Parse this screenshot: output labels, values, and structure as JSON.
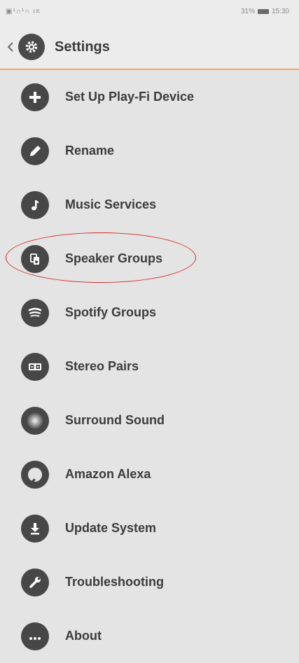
{
  "status_bar": {
    "left_text": "▣¹∩¹∩ ı≡",
    "right_text": "31%",
    "time": "15:30"
  },
  "header": {
    "back_icon": "chevron-left-icon",
    "icon": "gear-icon",
    "title": "Settings",
    "accent_color": "#f0a958"
  },
  "menu": {
    "items": [
      {
        "label": "Set Up Play-Fi Device",
        "icon": "plus-icon"
      },
      {
        "label": "Rename",
        "icon": "pencil-icon"
      },
      {
        "label": "Music Services",
        "icon": "music-note-icon"
      },
      {
        "label": "Speaker Groups",
        "icon": "speaker-group-icon"
      },
      {
        "label": "Spotify Groups",
        "icon": "spotify-icon"
      },
      {
        "label": "Stereo Pairs",
        "icon": "stereo-pair-icon"
      },
      {
        "label": "Surround Sound",
        "icon": "surround-sound-icon"
      },
      {
        "label": "Amazon Alexa",
        "icon": "alexa-icon"
      },
      {
        "label": "Update System",
        "icon": "download-icon"
      },
      {
        "label": "Troubleshooting",
        "icon": "wrench-icon"
      },
      {
        "label": "About",
        "icon": "more-icon"
      }
    ]
  },
  "annotation": {
    "highlight_color": "#d42a2a"
  }
}
